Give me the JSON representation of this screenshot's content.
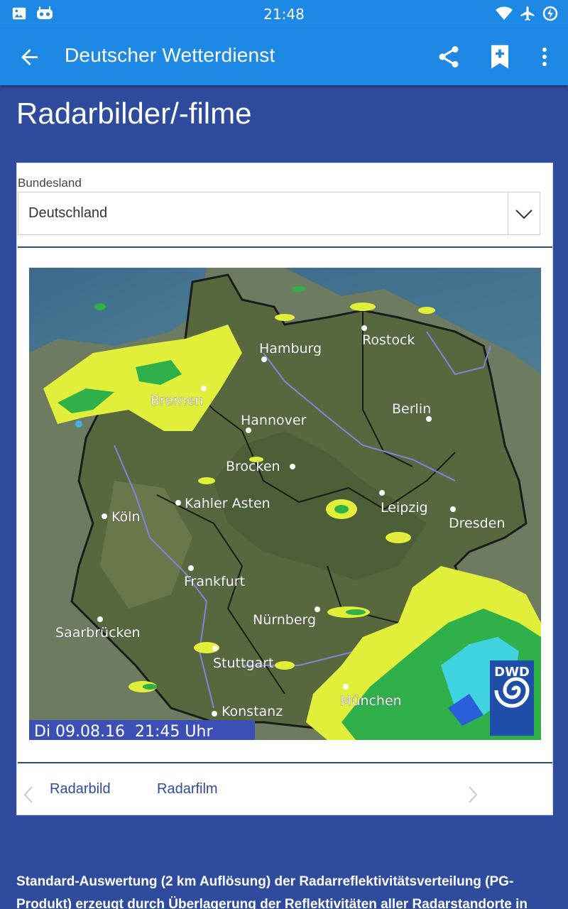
{
  "status_bar": {
    "time": "21:48",
    "left_icons": [
      "image-icon",
      "robot-icon"
    ],
    "right_icons": [
      "wifi-icon",
      "airplane-icon",
      "battery-charging-icon"
    ]
  },
  "app_bar": {
    "title": "Deutscher Wetterdienst",
    "actions": [
      "share-icon",
      "bookmark-add-icon",
      "more-vert-icon"
    ]
  },
  "page": {
    "title": "Radarbilder/-filme"
  },
  "region_select": {
    "label": "Bundesland",
    "value": "Deutschland"
  },
  "radar_image": {
    "cities": [
      "Hamburg",
      "Rostock",
      "Bremen",
      "Berlin",
      "Hannover",
      "Brocken",
      "Kahler Asten",
      "Köln",
      "Leipzig",
      "Dresden",
      "Frankfurt",
      "Saarbrücken",
      "Nürnberg",
      "Stuttgart",
      "München",
      "Konstanz"
    ],
    "timestamp": "Di 09.08.16  21:45 Uhr",
    "logo_text": "DWD"
  },
  "tabs": {
    "items": [
      "Radarbild",
      "Radarfilm"
    ]
  },
  "description": "Standard-Auswertung (2 km Auflösung) der Radarreflektivitätsverteilung (PG-Produkt) erzeugt durch Überlagerung der Reflektivitäten aller Radarstandorte in",
  "colors": {
    "app_bar": "#1e88e5",
    "background": "#2f4b9d",
    "accent_text": "#2f4b9d"
  }
}
